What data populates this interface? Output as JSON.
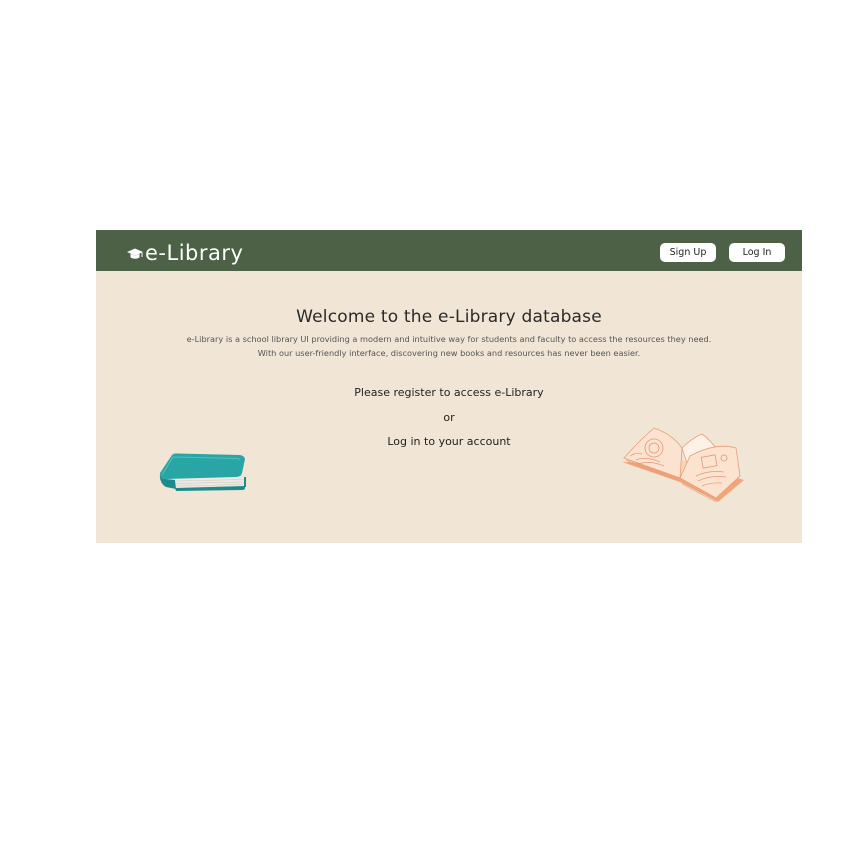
{
  "header": {
    "brand": "e-Library",
    "brand_icon": "graduation-cap-icon",
    "signup_label": "Sign Up",
    "login_label": "Log In"
  },
  "main": {
    "headline": "Welcome to the e-Library database",
    "description_line1": "e-Library is a school library UI providing a modern and intuitive way for students and faculty to access the resources they need.",
    "description_line2": "With our user-friendly interface, discovering new books and resources has never been easier.",
    "register_prompt": "Please register to access e-Library",
    "or_text": "or",
    "login_prompt": "Log in to your account"
  },
  "colors": {
    "navbar": "#4c6145",
    "background": "#f1e6d6",
    "book_left": "#2aa5a6",
    "book_right": "#f3a97f"
  },
  "illustrations": {
    "left": "closed-book-icon",
    "right": "open-book-icon"
  }
}
